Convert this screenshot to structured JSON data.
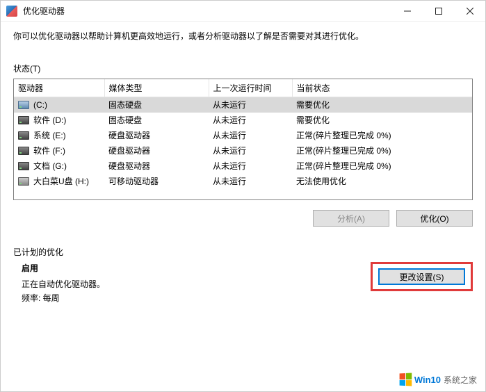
{
  "window": {
    "title": "优化驱动器"
  },
  "description": "你可以优化驱动器以帮助计算机更高效地运行，或者分析驱动器以了解是否需要对其进行优化。",
  "status_label": "状态(T)",
  "columns": {
    "drive": "驱动器",
    "media": "媒体类型",
    "lastrun": "上一次运行时间",
    "status": "当前状态"
  },
  "drives": [
    {
      "name": "(C:)",
      "icon": "c",
      "media": "固态硬盘",
      "lastrun": "从未运行",
      "status": "需要优化",
      "selected": true
    },
    {
      "name": "软件 (D:)",
      "icon": "dark",
      "media": "固态硬盘",
      "lastrun": "从未运行",
      "status": "需要优化",
      "selected": false
    },
    {
      "name": "系统 (E:)",
      "icon": "dark",
      "media": "硬盘驱动器",
      "lastrun": "从未运行",
      "status": "正常(碎片整理已完成 0%)",
      "selected": false
    },
    {
      "name": "软件 (F:)",
      "icon": "dark",
      "media": "硬盘驱动器",
      "lastrun": "从未运行",
      "status": "正常(碎片整理已完成 0%)",
      "selected": false
    },
    {
      "name": "文档 (G:)",
      "icon": "dark",
      "media": "硬盘驱动器",
      "lastrun": "从未运行",
      "status": "正常(碎片整理已完成 0%)",
      "selected": false
    },
    {
      "name": "大白菜U盘 (H:)",
      "icon": "usb",
      "media": "可移动驱动器",
      "lastrun": "从未运行",
      "status": "无法使用优化",
      "selected": false
    }
  ],
  "buttons": {
    "analyze": "分析(A)",
    "optimize": "优化(O)",
    "change_settings": "更改设置(S)"
  },
  "scheduled": {
    "header": "已计划的优化",
    "on": "启用",
    "line1": "正在自动优化驱动器。",
    "line2_prefix": "频率: ",
    "line2_value": "每周"
  },
  "watermark": {
    "win10": "Win10",
    "suffix": "系统之家"
  }
}
